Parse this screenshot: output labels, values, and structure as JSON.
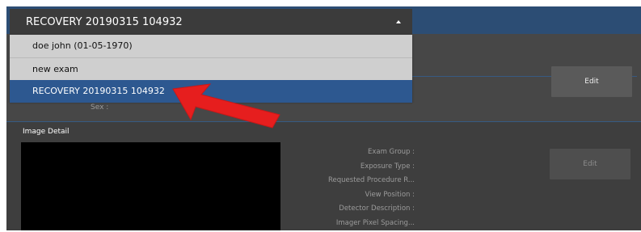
{
  "dropdown": {
    "selected": "RECOVERY 20190315 104932",
    "options": [
      "doe john (01-05-1970)",
      "new exam",
      "RECOVERY 20190315 104932"
    ]
  },
  "patient": {
    "sex_label": "Sex :"
  },
  "buttons": {
    "edit_top": "Edit",
    "edit_bottom": "Edit"
  },
  "image_detail": {
    "title": "Image Detail",
    "labels": [
      "Exam Group :",
      "Exposure Type :",
      "Requested Procedure R...",
      "View Position :",
      "Detector Description :",
      "Imager Pixel Spacing..."
    ]
  },
  "colors": {
    "accent": "#2d5890",
    "panel": "#3e3e3e",
    "arrow": "#e61e1e"
  }
}
